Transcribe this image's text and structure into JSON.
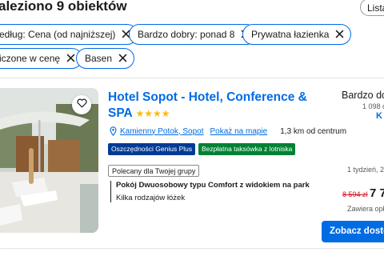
{
  "header": {
    "title": "aleziono 9 obiektów",
    "list_button": "Lista"
  },
  "filters": [
    {
      "label": "edług: Cena (od najniższej)"
    },
    {
      "label": "Bardzo dobry: ponad 8"
    },
    {
      "label": "Prywatna łazienka"
    },
    {
      "label": "iczone w cenę"
    },
    {
      "label": "Basen"
    }
  ],
  "hotel": {
    "name": "Hotel Sopot - Hotel, Conference & SPA",
    "stars": 4,
    "stars_text": "★★★★",
    "location_link": "Kamienny Potok, Sopot",
    "map_link": "Pokaż na mapie",
    "distance": "1,3 km od centrum",
    "badge_genius": "Oszczędności Genius Plus",
    "badge_taxi": "Bezpłatna taksówka z lotniska",
    "group_tag": "Polecany dla Twojej grupy",
    "room_name": "Pokój Dwuosobowy typu Comfort z widokiem na park",
    "room_beds": "Kilka rodzajów łóżek",
    "review_label": "Bardzo do",
    "review_count": "1 098 o",
    "review_extra": "K",
    "stay_info": "1 tydzień, 2",
    "old_price": "8 594 zł",
    "new_price": "7 7",
    "includes": "Zawiera opł",
    "cta": "Zobacz dostęp"
  },
  "colors": {
    "brand_blue": "#006ce4",
    "genius_blue": "#003b95",
    "taxi_green": "#008234",
    "star_yellow": "#febb02",
    "price_red": "#d4111e"
  },
  "icons": {
    "heart": "heart-icon",
    "close": "close-icon",
    "pin": "pin-icon"
  }
}
